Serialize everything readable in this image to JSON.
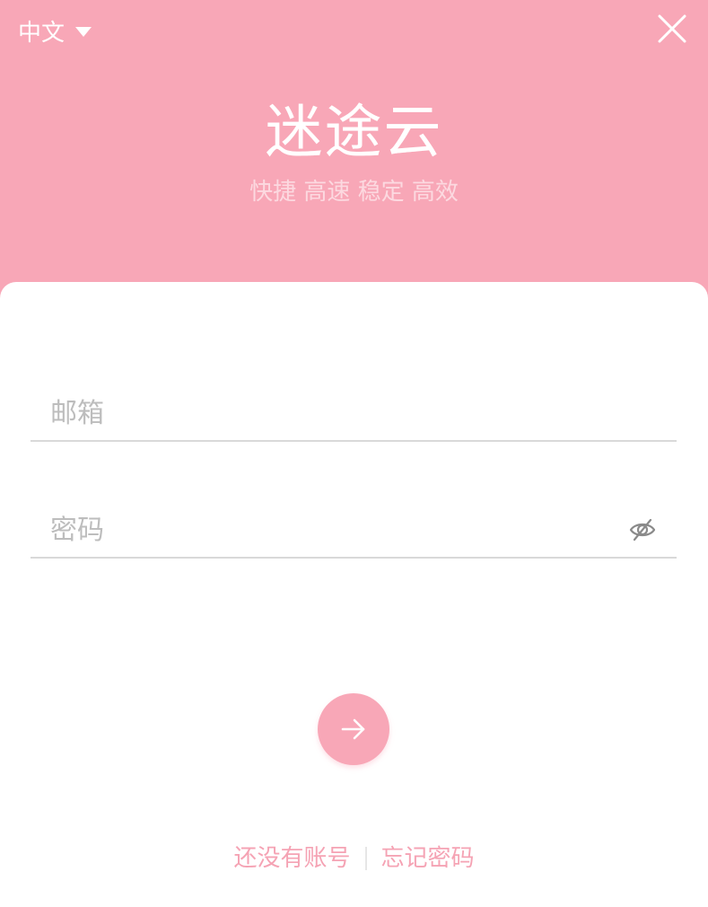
{
  "header": {
    "language": "中文",
    "app_title": "迷途云",
    "app_subtitle": "快捷 高速 稳定 高效"
  },
  "form": {
    "email": {
      "value": "",
      "placeholder": "邮箱"
    },
    "password": {
      "value": "",
      "placeholder": "密码"
    }
  },
  "footer": {
    "register_link": "还没有账号",
    "forgot_link": "忘记密码"
  },
  "colors": {
    "brand_pink": "#f8a7b7",
    "subtitle_pink": "#fcd9e0",
    "link_pink": "#f5a3b4"
  },
  "icons": {
    "language_dropdown": "caret-down-icon",
    "close": "close-icon",
    "password_toggle": "eye-off-icon",
    "submit": "arrow-right-icon"
  }
}
